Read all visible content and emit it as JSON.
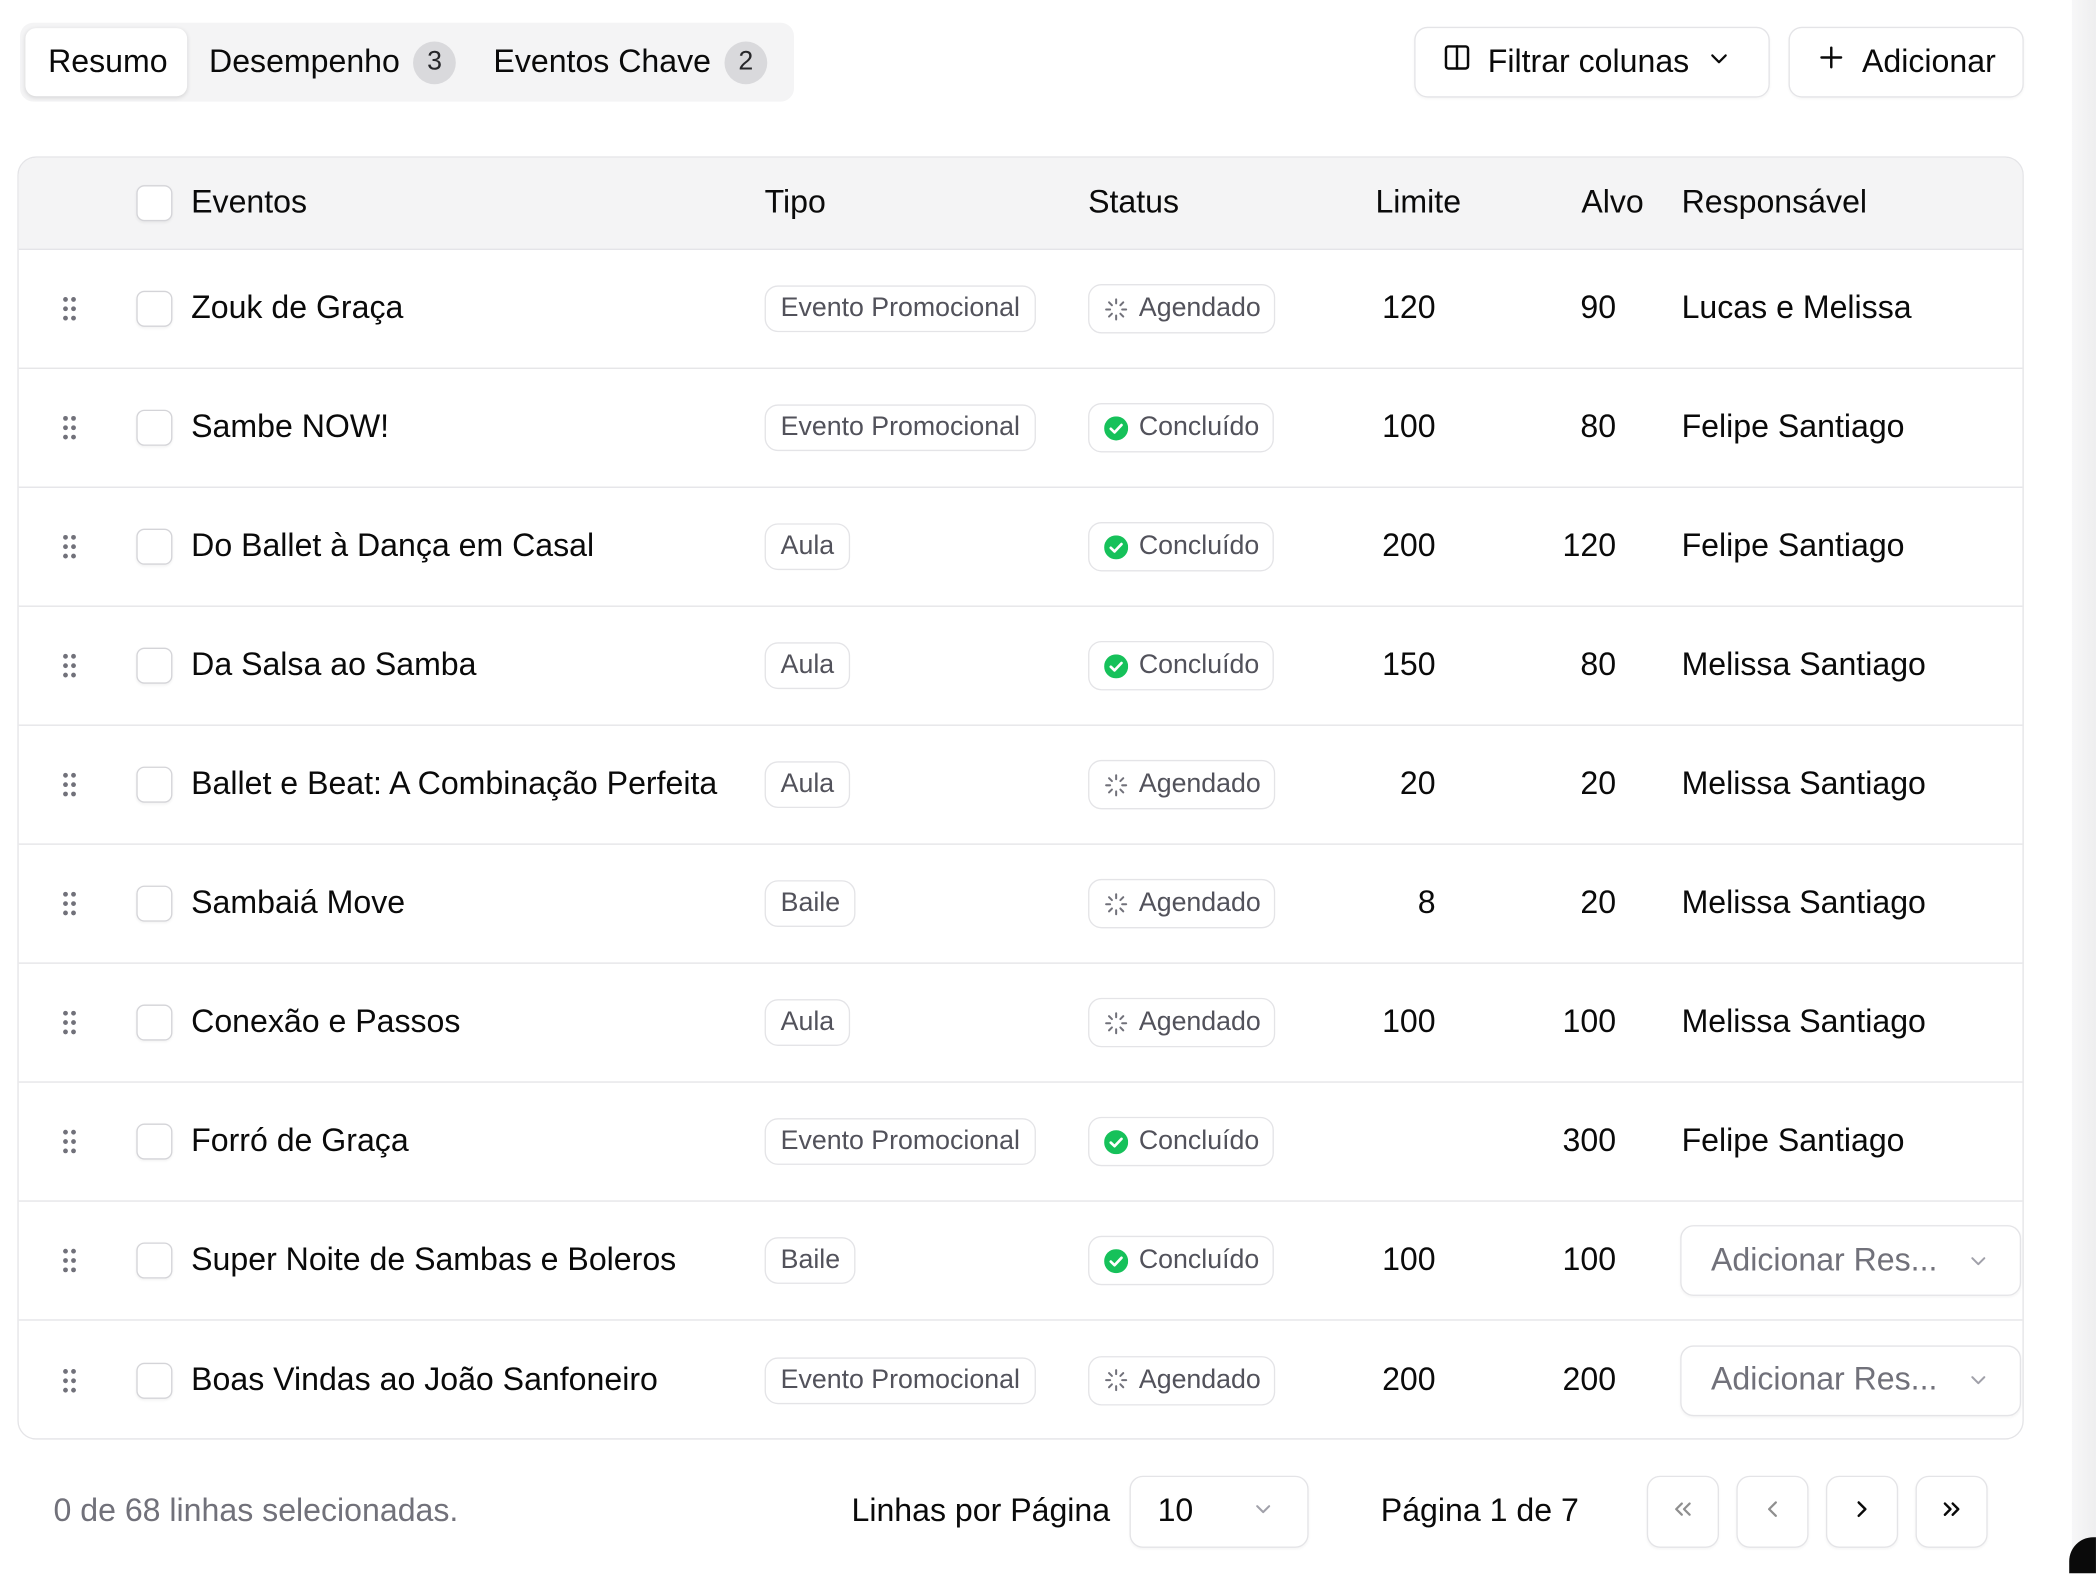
{
  "tabs": [
    {
      "label": "Resumo",
      "badge": null,
      "active": true
    },
    {
      "label": "Desempenho",
      "badge": "3",
      "active": false
    },
    {
      "label": "Eventos Chave",
      "badge": "2",
      "active": false
    }
  ],
  "toolbar": {
    "filter_label": "Filtrar colunas",
    "add_label": "Adicionar"
  },
  "table": {
    "headers": {
      "events": "Eventos",
      "type": "Tipo",
      "status": "Status",
      "limit": "Limite",
      "target": "Alvo",
      "owner": "Responsável"
    },
    "rows": [
      {
        "event": "Zouk de Graça",
        "type": "Evento Promocional",
        "status": "Agendado",
        "status_kind": "scheduled",
        "limit": "120",
        "target": "90",
        "owner": "Lucas e Melissa",
        "owner_is_select": false
      },
      {
        "event": "Sambe NOW!",
        "type": "Evento Promocional",
        "status": "Concluído",
        "status_kind": "done",
        "limit": "100",
        "target": "80",
        "owner": "Felipe Santiago",
        "owner_is_select": false
      },
      {
        "event": "Do Ballet à Dança em Casal",
        "type": "Aula",
        "status": "Concluído",
        "status_kind": "done",
        "limit": "200",
        "target": "120",
        "owner": "Felipe Santiago",
        "owner_is_select": false
      },
      {
        "event": "Da Salsa ao Samba",
        "type": "Aula",
        "status": "Concluído",
        "status_kind": "done",
        "limit": "150",
        "target": "80",
        "owner": "Melissa Santiago",
        "owner_is_select": false
      },
      {
        "event": "Ballet e Beat: A Combinação Perfeita",
        "type": "Aula",
        "status": "Agendado",
        "status_kind": "scheduled",
        "limit": "20",
        "target": "20",
        "owner": "Melissa Santiago",
        "owner_is_select": false
      },
      {
        "event": "Sambaiá Move",
        "type": "Baile",
        "status": "Agendado",
        "status_kind": "scheduled",
        "limit": "8",
        "target": "20",
        "owner": "Melissa Santiago",
        "owner_is_select": false
      },
      {
        "event": "Conexão e Passos",
        "type": "Aula",
        "status": "Agendado",
        "status_kind": "scheduled",
        "limit": "100",
        "target": "100",
        "owner": "Melissa Santiago",
        "owner_is_select": false
      },
      {
        "event": "Forró de Graça",
        "type": "Evento Promocional",
        "status": "Concluído",
        "status_kind": "done",
        "limit": "",
        "target": "300",
        "owner": "Felipe Santiago",
        "owner_is_select": false
      },
      {
        "event": "Super Noite de Sambas e Boleros",
        "type": "Baile",
        "status": "Concluído",
        "status_kind": "done",
        "limit": "100",
        "target": "100",
        "owner": "Adicionar Res...",
        "owner_is_select": true
      },
      {
        "event": "Boas Vindas ao João Sanfoneiro",
        "type": "Evento Promocional",
        "status": "Agendado",
        "status_kind": "scheduled",
        "limit": "200",
        "target": "200",
        "owner": "Adicionar Res...",
        "owner_is_select": true
      }
    ]
  },
  "footer": {
    "selection_text": "0 de 68 linhas selecionadas.",
    "rows_per_page_label": "Linhas por Página",
    "rows_per_page_value": "10",
    "page_text": "Página 1 de 7"
  },
  "colors": {
    "done": "#16c15a",
    "scheduled_icon": "#71717a",
    "border": "#e4e4e7",
    "header_bg": "#f4f4f5"
  }
}
